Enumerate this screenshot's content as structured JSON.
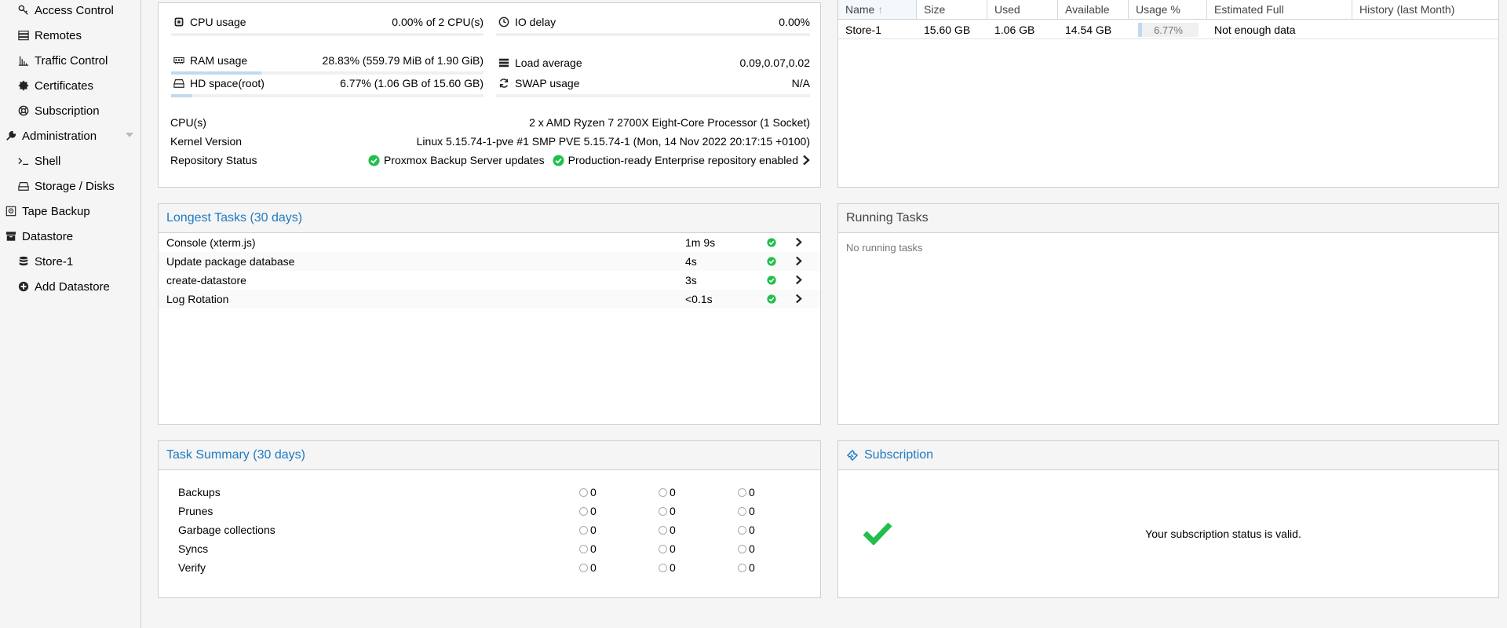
{
  "sidebar": {
    "items": [
      {
        "label": "Access Control",
        "icon": "key-icon"
      },
      {
        "label": "Remotes",
        "icon": "server-icon"
      },
      {
        "label": "Traffic Control",
        "icon": "signal-icon"
      },
      {
        "label": "Certificates",
        "icon": "certificate-icon"
      },
      {
        "label": "Subscription",
        "icon": "support-icon"
      },
      {
        "label": "Administration",
        "icon": "wrench-icon"
      },
      {
        "label": "Shell",
        "icon": "terminal-icon"
      },
      {
        "label": "Storage / Disks",
        "icon": "hdd-icon"
      },
      {
        "label": "Tape Backup",
        "icon": "tape-icon"
      },
      {
        "label": "Datastore",
        "icon": "archive-icon"
      },
      {
        "label": "Store-1",
        "icon": "database-icon"
      },
      {
        "label": "Add Datastore",
        "icon": "plus-circle-icon"
      }
    ]
  },
  "status": {
    "cpu": {
      "label": "CPU usage",
      "value": "0.00% of 2 CPU(s)",
      "fill": 0.0
    },
    "io": {
      "label": "IO delay",
      "value": "0.00%",
      "fill": 0.0
    },
    "ram": {
      "label": "RAM usage",
      "value": "28.83% (559.79 MiB of 1.90 GiB)",
      "fill": 0.2883
    },
    "load": {
      "label": "Load average",
      "value": "0.09,0.07,0.02"
    },
    "hd": {
      "label": "HD space(root)",
      "value": "6.77% (1.06 GB of 15.60 GB)",
      "fill": 0.0677
    },
    "swap": {
      "label": "SWAP usage",
      "value": "N/A"
    },
    "cpus": {
      "label": "CPU(s)",
      "value": "2 x AMD Ryzen 7 2700X Eight-Core Processor (1 Socket)"
    },
    "kernel": {
      "label": "Kernel Version",
      "value": "Linux 5.15.74-1-pve #1 SMP PVE 5.15.74-1 (Mon, 14 Nov 2022 20:17:15 +0100)"
    },
    "repo": {
      "label": "Repository Status",
      "updates": "Proxmox Backup Server updates",
      "enterprise": "Production-ready Enterprise repository enabled"
    }
  },
  "datastores": {
    "columns": [
      "Name",
      "Size",
      "Used",
      "Available",
      "Usage %",
      "Estimated Full",
      "History (last Month)"
    ],
    "rows": [
      {
        "name": "Store-1",
        "size": "15.60 GB",
        "used": "1.06 GB",
        "available": "14.54 GB",
        "usage": "6.77%",
        "usage_fill": 0.0677,
        "estimated": "Not enough data"
      }
    ]
  },
  "longest_tasks": {
    "title": "Longest Tasks (30 days)",
    "rows": [
      {
        "name": "Console (xterm.js)",
        "duration": "1m 9s"
      },
      {
        "name": "Update package database",
        "duration": "4s"
      },
      {
        "name": "create-datastore",
        "duration": "3s"
      },
      {
        "name": "Log Rotation",
        "duration": "<0.1s"
      }
    ]
  },
  "running_tasks": {
    "title": "Running Tasks",
    "empty": "No running tasks"
  },
  "task_summary": {
    "title": "Task Summary (30 days)",
    "rows": [
      {
        "label": "Backups",
        "a": "0",
        "b": "0",
        "c": "0"
      },
      {
        "label": "Prunes",
        "a": "0",
        "b": "0",
        "c": "0"
      },
      {
        "label": "Garbage collections",
        "a": "0",
        "b": "0",
        "c": "0"
      },
      {
        "label": "Syncs",
        "a": "0",
        "b": "0",
        "c": "0"
      },
      {
        "label": "Verify",
        "a": "0",
        "b": "0",
        "c": "0"
      }
    ]
  },
  "subscription": {
    "title": "Subscription",
    "message": "Your subscription status is valid."
  },
  "colors": {
    "accent": "#1f7ac2",
    "ok": "#21bf4b",
    "bar": "#c0d9ef"
  }
}
